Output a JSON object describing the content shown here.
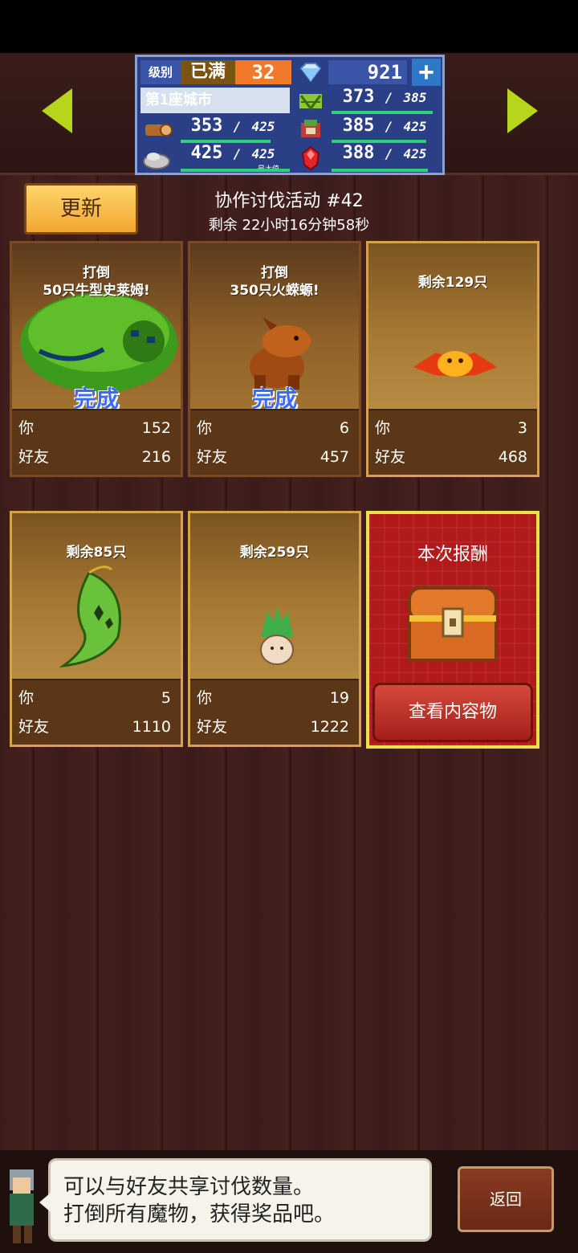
{
  "header": {
    "level_label": "级别",
    "level_status": "已满",
    "level_value": "32",
    "gems": "921",
    "plus": "+",
    "city": "第1座城市",
    "resources": {
      "grass": {
        "value": "373",
        "max": "385"
      },
      "wood": {
        "value": "353",
        "max": "425"
      },
      "food": {
        "value": "385",
        "max": "425"
      },
      "stone": {
        "value": "425",
        "max": "425",
        "tag": "最大值"
      },
      "ruby": {
        "value": "388",
        "max": "425"
      }
    },
    "sep": "/"
  },
  "event": {
    "refresh_label": "更新",
    "title": "协作讨伐活动 #42",
    "remaining": "剩余 22小时16分钟58秒"
  },
  "labels": {
    "you": "你",
    "friends": "好友",
    "done": "完成"
  },
  "cards": [
    {
      "caption": "打倒\n50只牛型史莱姆!",
      "line1": "打倒",
      "line2": "50只牛型史莱姆!",
      "done": true,
      "you": "152",
      "friends": "216",
      "monster": "slime-icon"
    },
    {
      "caption": "打倒\n350只火蝾螈!",
      "line1": "打倒",
      "line2": "350只火蝾螈!",
      "done": true,
      "you": "6",
      "friends": "457",
      "monster": "salamander-icon"
    },
    {
      "line1": "剩余129只",
      "line2": "",
      "done": false,
      "you": "3",
      "friends": "468",
      "monster": "bat-icon"
    },
    {
      "line1": "剩余85只",
      "line2": "",
      "done": false,
      "you": "5",
      "friends": "1110",
      "monster": "leaf-spirit-icon"
    },
    {
      "line1": "剩余259只",
      "line2": "",
      "done": false,
      "you": "19",
      "friends": "1222",
      "monster": "mandrake-icon"
    }
  ],
  "reward": {
    "title": "本次报酬",
    "button": "查看内容物"
  },
  "tip": {
    "line1": "可以与好友共享讨伐数量。",
    "line2": "打倒所有魔物，获得奖品吧。"
  },
  "back_label": "返回",
  "colors": {
    "accent_green": "#b7d51b",
    "card_brown": "#8f6128",
    "reward_red": "#b1191a",
    "done_blue": "#3a6bff"
  }
}
